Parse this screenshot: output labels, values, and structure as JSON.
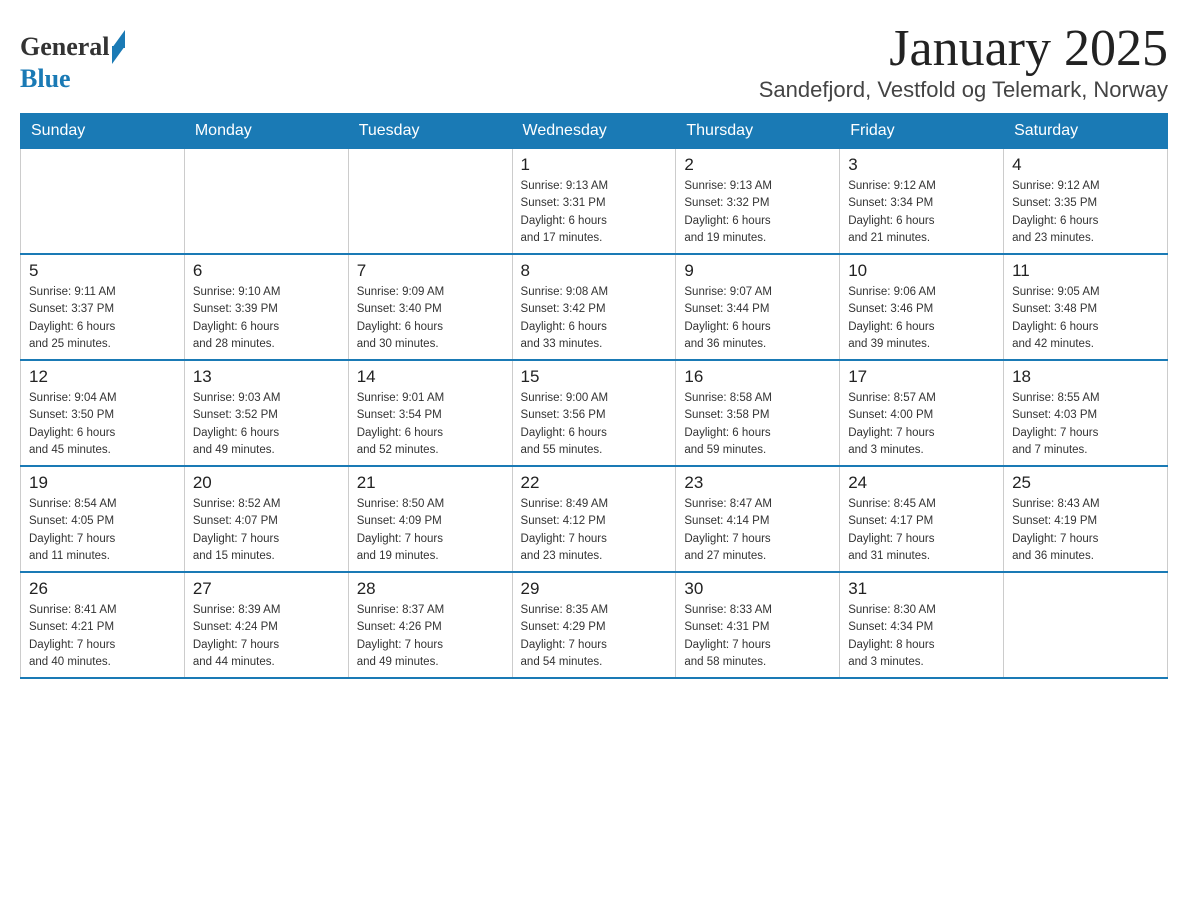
{
  "header": {
    "logo_general": "General",
    "logo_blue": "Blue",
    "month_title": "January 2025",
    "location": "Sandefjord, Vestfold og Telemark, Norway"
  },
  "days_of_week": [
    "Sunday",
    "Monday",
    "Tuesday",
    "Wednesday",
    "Thursday",
    "Friday",
    "Saturday"
  ],
  "weeks": [
    [
      {
        "day": "",
        "info": ""
      },
      {
        "day": "",
        "info": ""
      },
      {
        "day": "",
        "info": ""
      },
      {
        "day": "1",
        "info": "Sunrise: 9:13 AM\nSunset: 3:31 PM\nDaylight: 6 hours\nand 17 minutes."
      },
      {
        "day": "2",
        "info": "Sunrise: 9:13 AM\nSunset: 3:32 PM\nDaylight: 6 hours\nand 19 minutes."
      },
      {
        "day": "3",
        "info": "Sunrise: 9:12 AM\nSunset: 3:34 PM\nDaylight: 6 hours\nand 21 minutes."
      },
      {
        "day": "4",
        "info": "Sunrise: 9:12 AM\nSunset: 3:35 PM\nDaylight: 6 hours\nand 23 minutes."
      }
    ],
    [
      {
        "day": "5",
        "info": "Sunrise: 9:11 AM\nSunset: 3:37 PM\nDaylight: 6 hours\nand 25 minutes."
      },
      {
        "day": "6",
        "info": "Sunrise: 9:10 AM\nSunset: 3:39 PM\nDaylight: 6 hours\nand 28 minutes."
      },
      {
        "day": "7",
        "info": "Sunrise: 9:09 AM\nSunset: 3:40 PM\nDaylight: 6 hours\nand 30 minutes."
      },
      {
        "day": "8",
        "info": "Sunrise: 9:08 AM\nSunset: 3:42 PM\nDaylight: 6 hours\nand 33 minutes."
      },
      {
        "day": "9",
        "info": "Sunrise: 9:07 AM\nSunset: 3:44 PM\nDaylight: 6 hours\nand 36 minutes."
      },
      {
        "day": "10",
        "info": "Sunrise: 9:06 AM\nSunset: 3:46 PM\nDaylight: 6 hours\nand 39 minutes."
      },
      {
        "day": "11",
        "info": "Sunrise: 9:05 AM\nSunset: 3:48 PM\nDaylight: 6 hours\nand 42 minutes."
      }
    ],
    [
      {
        "day": "12",
        "info": "Sunrise: 9:04 AM\nSunset: 3:50 PM\nDaylight: 6 hours\nand 45 minutes."
      },
      {
        "day": "13",
        "info": "Sunrise: 9:03 AM\nSunset: 3:52 PM\nDaylight: 6 hours\nand 49 minutes."
      },
      {
        "day": "14",
        "info": "Sunrise: 9:01 AM\nSunset: 3:54 PM\nDaylight: 6 hours\nand 52 minutes."
      },
      {
        "day": "15",
        "info": "Sunrise: 9:00 AM\nSunset: 3:56 PM\nDaylight: 6 hours\nand 55 minutes."
      },
      {
        "day": "16",
        "info": "Sunrise: 8:58 AM\nSunset: 3:58 PM\nDaylight: 6 hours\nand 59 minutes."
      },
      {
        "day": "17",
        "info": "Sunrise: 8:57 AM\nSunset: 4:00 PM\nDaylight: 7 hours\nand 3 minutes."
      },
      {
        "day": "18",
        "info": "Sunrise: 8:55 AM\nSunset: 4:03 PM\nDaylight: 7 hours\nand 7 minutes."
      }
    ],
    [
      {
        "day": "19",
        "info": "Sunrise: 8:54 AM\nSunset: 4:05 PM\nDaylight: 7 hours\nand 11 minutes."
      },
      {
        "day": "20",
        "info": "Sunrise: 8:52 AM\nSunset: 4:07 PM\nDaylight: 7 hours\nand 15 minutes."
      },
      {
        "day": "21",
        "info": "Sunrise: 8:50 AM\nSunset: 4:09 PM\nDaylight: 7 hours\nand 19 minutes."
      },
      {
        "day": "22",
        "info": "Sunrise: 8:49 AM\nSunset: 4:12 PM\nDaylight: 7 hours\nand 23 minutes."
      },
      {
        "day": "23",
        "info": "Sunrise: 8:47 AM\nSunset: 4:14 PM\nDaylight: 7 hours\nand 27 minutes."
      },
      {
        "day": "24",
        "info": "Sunrise: 8:45 AM\nSunset: 4:17 PM\nDaylight: 7 hours\nand 31 minutes."
      },
      {
        "day": "25",
        "info": "Sunrise: 8:43 AM\nSunset: 4:19 PM\nDaylight: 7 hours\nand 36 minutes."
      }
    ],
    [
      {
        "day": "26",
        "info": "Sunrise: 8:41 AM\nSunset: 4:21 PM\nDaylight: 7 hours\nand 40 minutes."
      },
      {
        "day": "27",
        "info": "Sunrise: 8:39 AM\nSunset: 4:24 PM\nDaylight: 7 hours\nand 44 minutes."
      },
      {
        "day": "28",
        "info": "Sunrise: 8:37 AM\nSunset: 4:26 PM\nDaylight: 7 hours\nand 49 minutes."
      },
      {
        "day": "29",
        "info": "Sunrise: 8:35 AM\nSunset: 4:29 PM\nDaylight: 7 hours\nand 54 minutes."
      },
      {
        "day": "30",
        "info": "Sunrise: 8:33 AM\nSunset: 4:31 PM\nDaylight: 7 hours\nand 58 minutes."
      },
      {
        "day": "31",
        "info": "Sunrise: 8:30 AM\nSunset: 4:34 PM\nDaylight: 8 hours\nand 3 minutes."
      },
      {
        "day": "",
        "info": ""
      }
    ]
  ]
}
